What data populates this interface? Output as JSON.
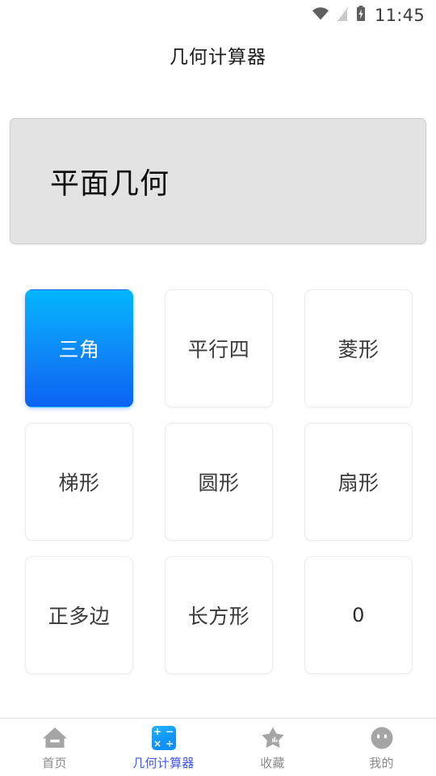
{
  "statusbar": {
    "wifi_icon": "wifi-icon",
    "signal_icon": "no-signal-icon",
    "battery_icon": "battery-charging-icon",
    "time": "11:45"
  },
  "header": {
    "title": "几何计算器"
  },
  "category_card": {
    "label": "平面几何",
    "background": "#e3e3e3",
    "border": "#cfcfcf"
  },
  "shape_grid": {
    "accent_start": "#02b6fb",
    "accent_end": "#0a63f2",
    "tiles": [
      {
        "label": "三角",
        "selected": true
      },
      {
        "label": "平行四",
        "selected": false
      },
      {
        "label": "菱形",
        "selected": false
      },
      {
        "label": "梯形",
        "selected": false
      },
      {
        "label": "圆形",
        "selected": false
      },
      {
        "label": "扇形",
        "selected": false
      },
      {
        "label": "正多边",
        "selected": false
      },
      {
        "label": "长方形",
        "selected": false
      },
      {
        "label": "0",
        "selected": false
      }
    ]
  },
  "bottom_nav": {
    "active_color": "#4057ee",
    "inactive_color": "#8a8a8a",
    "items": [
      {
        "label": "首页",
        "icon": "home-icon",
        "active": false
      },
      {
        "label": "几何计算器",
        "icon": "calculator-icon",
        "active": true
      },
      {
        "label": "收藏",
        "icon": "star-icon",
        "active": false
      },
      {
        "label": "我的",
        "icon": "profile-face-icon",
        "active": false
      }
    ]
  },
  "calculator_icon_symbols": {
    "plus": "+",
    "minus": "−",
    "times": "×",
    "divide": "÷"
  }
}
